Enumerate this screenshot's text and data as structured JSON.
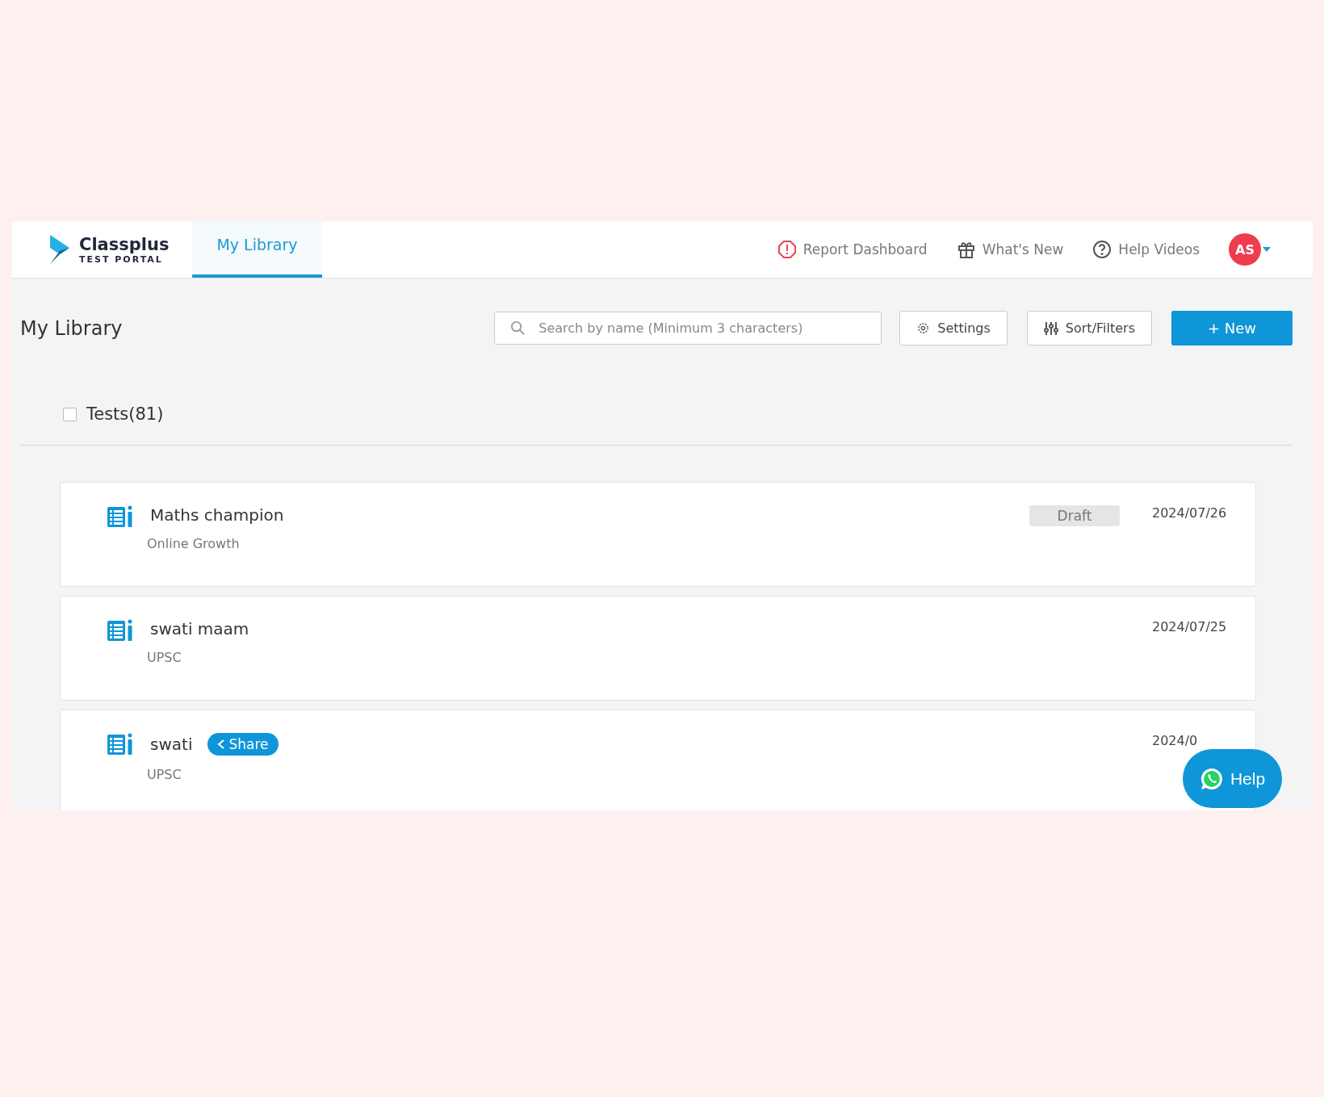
{
  "header": {
    "logo": {
      "name": "Classplus",
      "tagline": "TEST PORTAL"
    },
    "tabs": [
      {
        "label": "My Library",
        "selected": true
      }
    ],
    "nav": [
      {
        "kind": "report",
        "label": "Report Dashboard"
      },
      {
        "kind": "gift",
        "label": "What's New"
      },
      {
        "kind": "help",
        "label": "Help Videos"
      }
    ],
    "avatar": "AS"
  },
  "toolbar": {
    "title": "My Library",
    "search": {
      "placeholder": "Search by name (Minimum 3 characters)"
    },
    "settings": "Settings",
    "filters": "Sort/Filters",
    "new": "+ New"
  },
  "select_all": {
    "label": "Tests(81)",
    "checked": false
  },
  "tests": [
    {
      "title": "Maths champion",
      "subtitle": "Online Growth",
      "status": "Draft",
      "date": "2024/07/26"
    },
    {
      "title": "swati maam",
      "subtitle": "UPSC",
      "date": "2024/07/25"
    },
    {
      "title": "swati",
      "subtitle": "UPSC",
      "share": "Share",
      "date": "2024/0"
    }
  ],
  "help_button": "Help"
}
